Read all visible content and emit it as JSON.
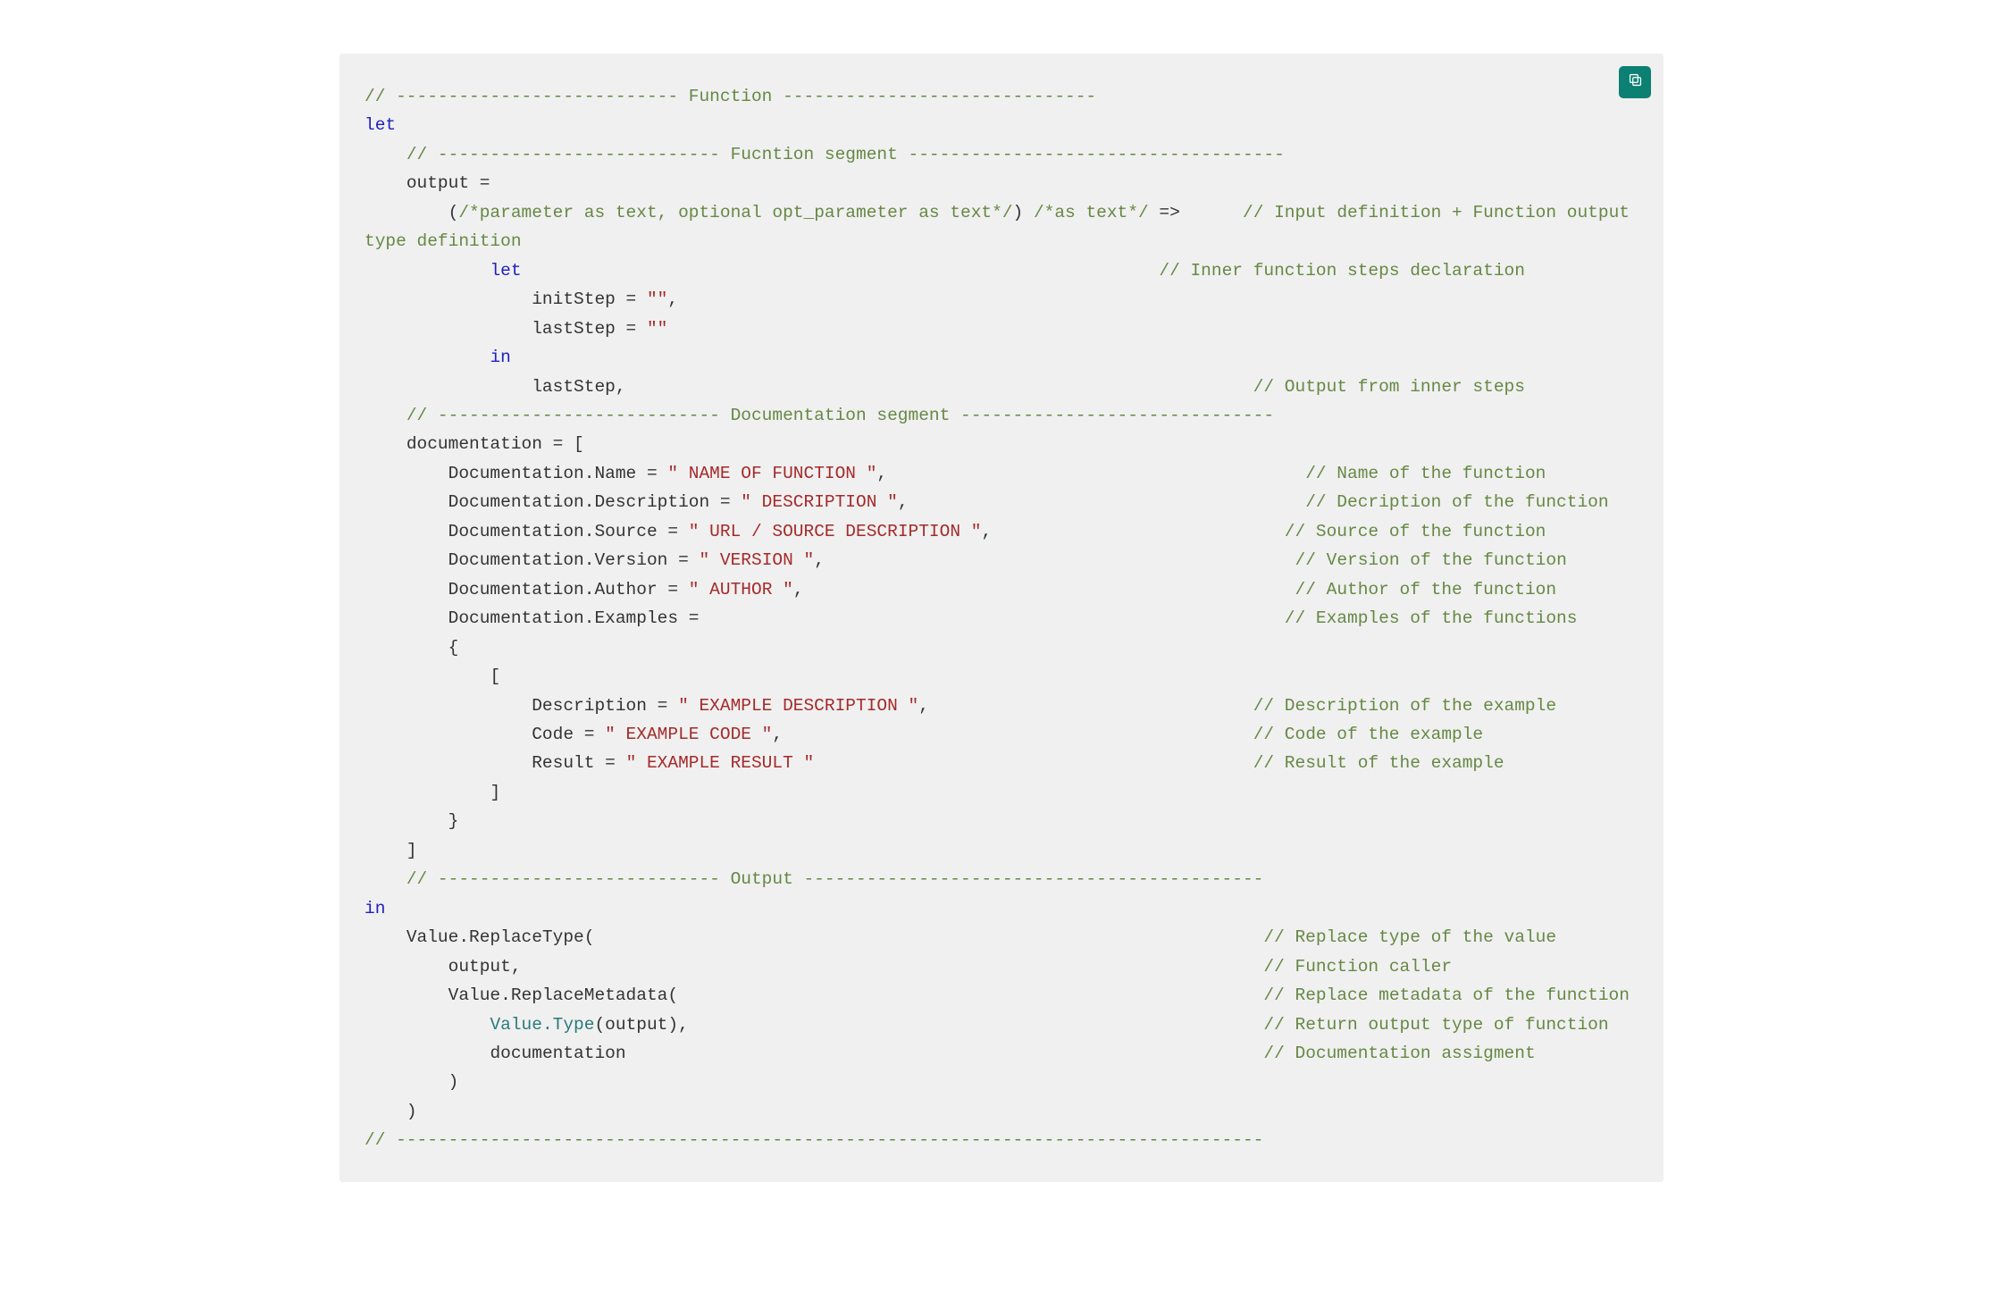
{
  "copy_button": {
    "icon_name": "copy-icon"
  },
  "comments": {
    "sect_func": "// --------------------------- Function ------------------------------",
    "sect_fsegment": "// --------------------------- Fucntion segment ------------------------------------",
    "c_input_def": "// Input definition + Function output type definition",
    "c_inner_decl": "// Inner function steps declaration",
    "c_output_inner": "// Output from inner steps",
    "sect_docseg": "// --------------------------- Documentation segment ------------------------------",
    "c_name": "// Name of the function",
    "c_descr": "// Decription of the function",
    "c_source": "// Source of the function",
    "c_version": "// Version of the function",
    "c_author": "// Author of the function",
    "c_examples": "// Examples of the functions",
    "c_ex_descr": "// Description of the example",
    "c_ex_code": "// Code of the example",
    "c_ex_result": "// Result of the example",
    "sect_output": "// --------------------------- Output --------------------------------------------",
    "c_replace_type": "// Replace type of the value",
    "c_func_caller": "// Function caller",
    "c_replace_meta": "// Replace metadata of the function",
    "c_return_type": "// Return output type of function",
    "c_doc_assign": "// Documentation assigment",
    "final_rule": "// -----------------------------------------------------------------------------------"
  },
  "keywords": {
    "let": "let",
    "in": "in"
  },
  "code_plain": {
    "output_eq": "output =",
    "params_comment": "/*parameter as text, optional opt_parameter as text*/",
    "as_text_comment": "/*as text*/",
    "arrow": "=>",
    "initStep": "initStep = ",
    "lastStep_assign": "lastStep = ",
    "lastStep_call": "lastStep,",
    "doc_eq": "documentation = [",
    "doc_name": "Documentation.Name = ",
    "doc_desc": "Documentation.Description = ",
    "doc_src": "Documentation.Source = ",
    "doc_ver": "Documentation.Version = ",
    "doc_auth": "Documentation.Author = ",
    "doc_ex": "Documentation.Examples =",
    "brace_open": "{",
    "bracket_open": "[",
    "ex_desc": "Description = ",
    "ex_code": "Code = ",
    "ex_res": "Result = ",
    "bracket_close": "]",
    "brace_close": "}",
    "doc_close": "]",
    "vrt_open": "Value.ReplaceType(",
    "output_arg": "output,",
    "vrm_open": "Value.ReplaceMetadata(",
    "vtype": "Value.Type",
    "vtype_tail": "(output),",
    "doc_ident": "documentation",
    "paren_close": ")",
    "comma": ","
  },
  "strings": {
    "empty": "\"\"",
    "name": "\" NAME OF FUNCTION \"",
    "descr": "\" DESCRIPTION \"",
    "source": "\" URL / SOURCE DESCRIPTION \"",
    "version": "\" VERSION \"",
    "author": "\" AUTHOR \"",
    "ex_descr": "\" EXAMPLE DESCRIPTION \"",
    "ex_code": "\" EXAMPLE CODE \"",
    "ex_result": "\" EXAMPLE RESULT \""
  }
}
